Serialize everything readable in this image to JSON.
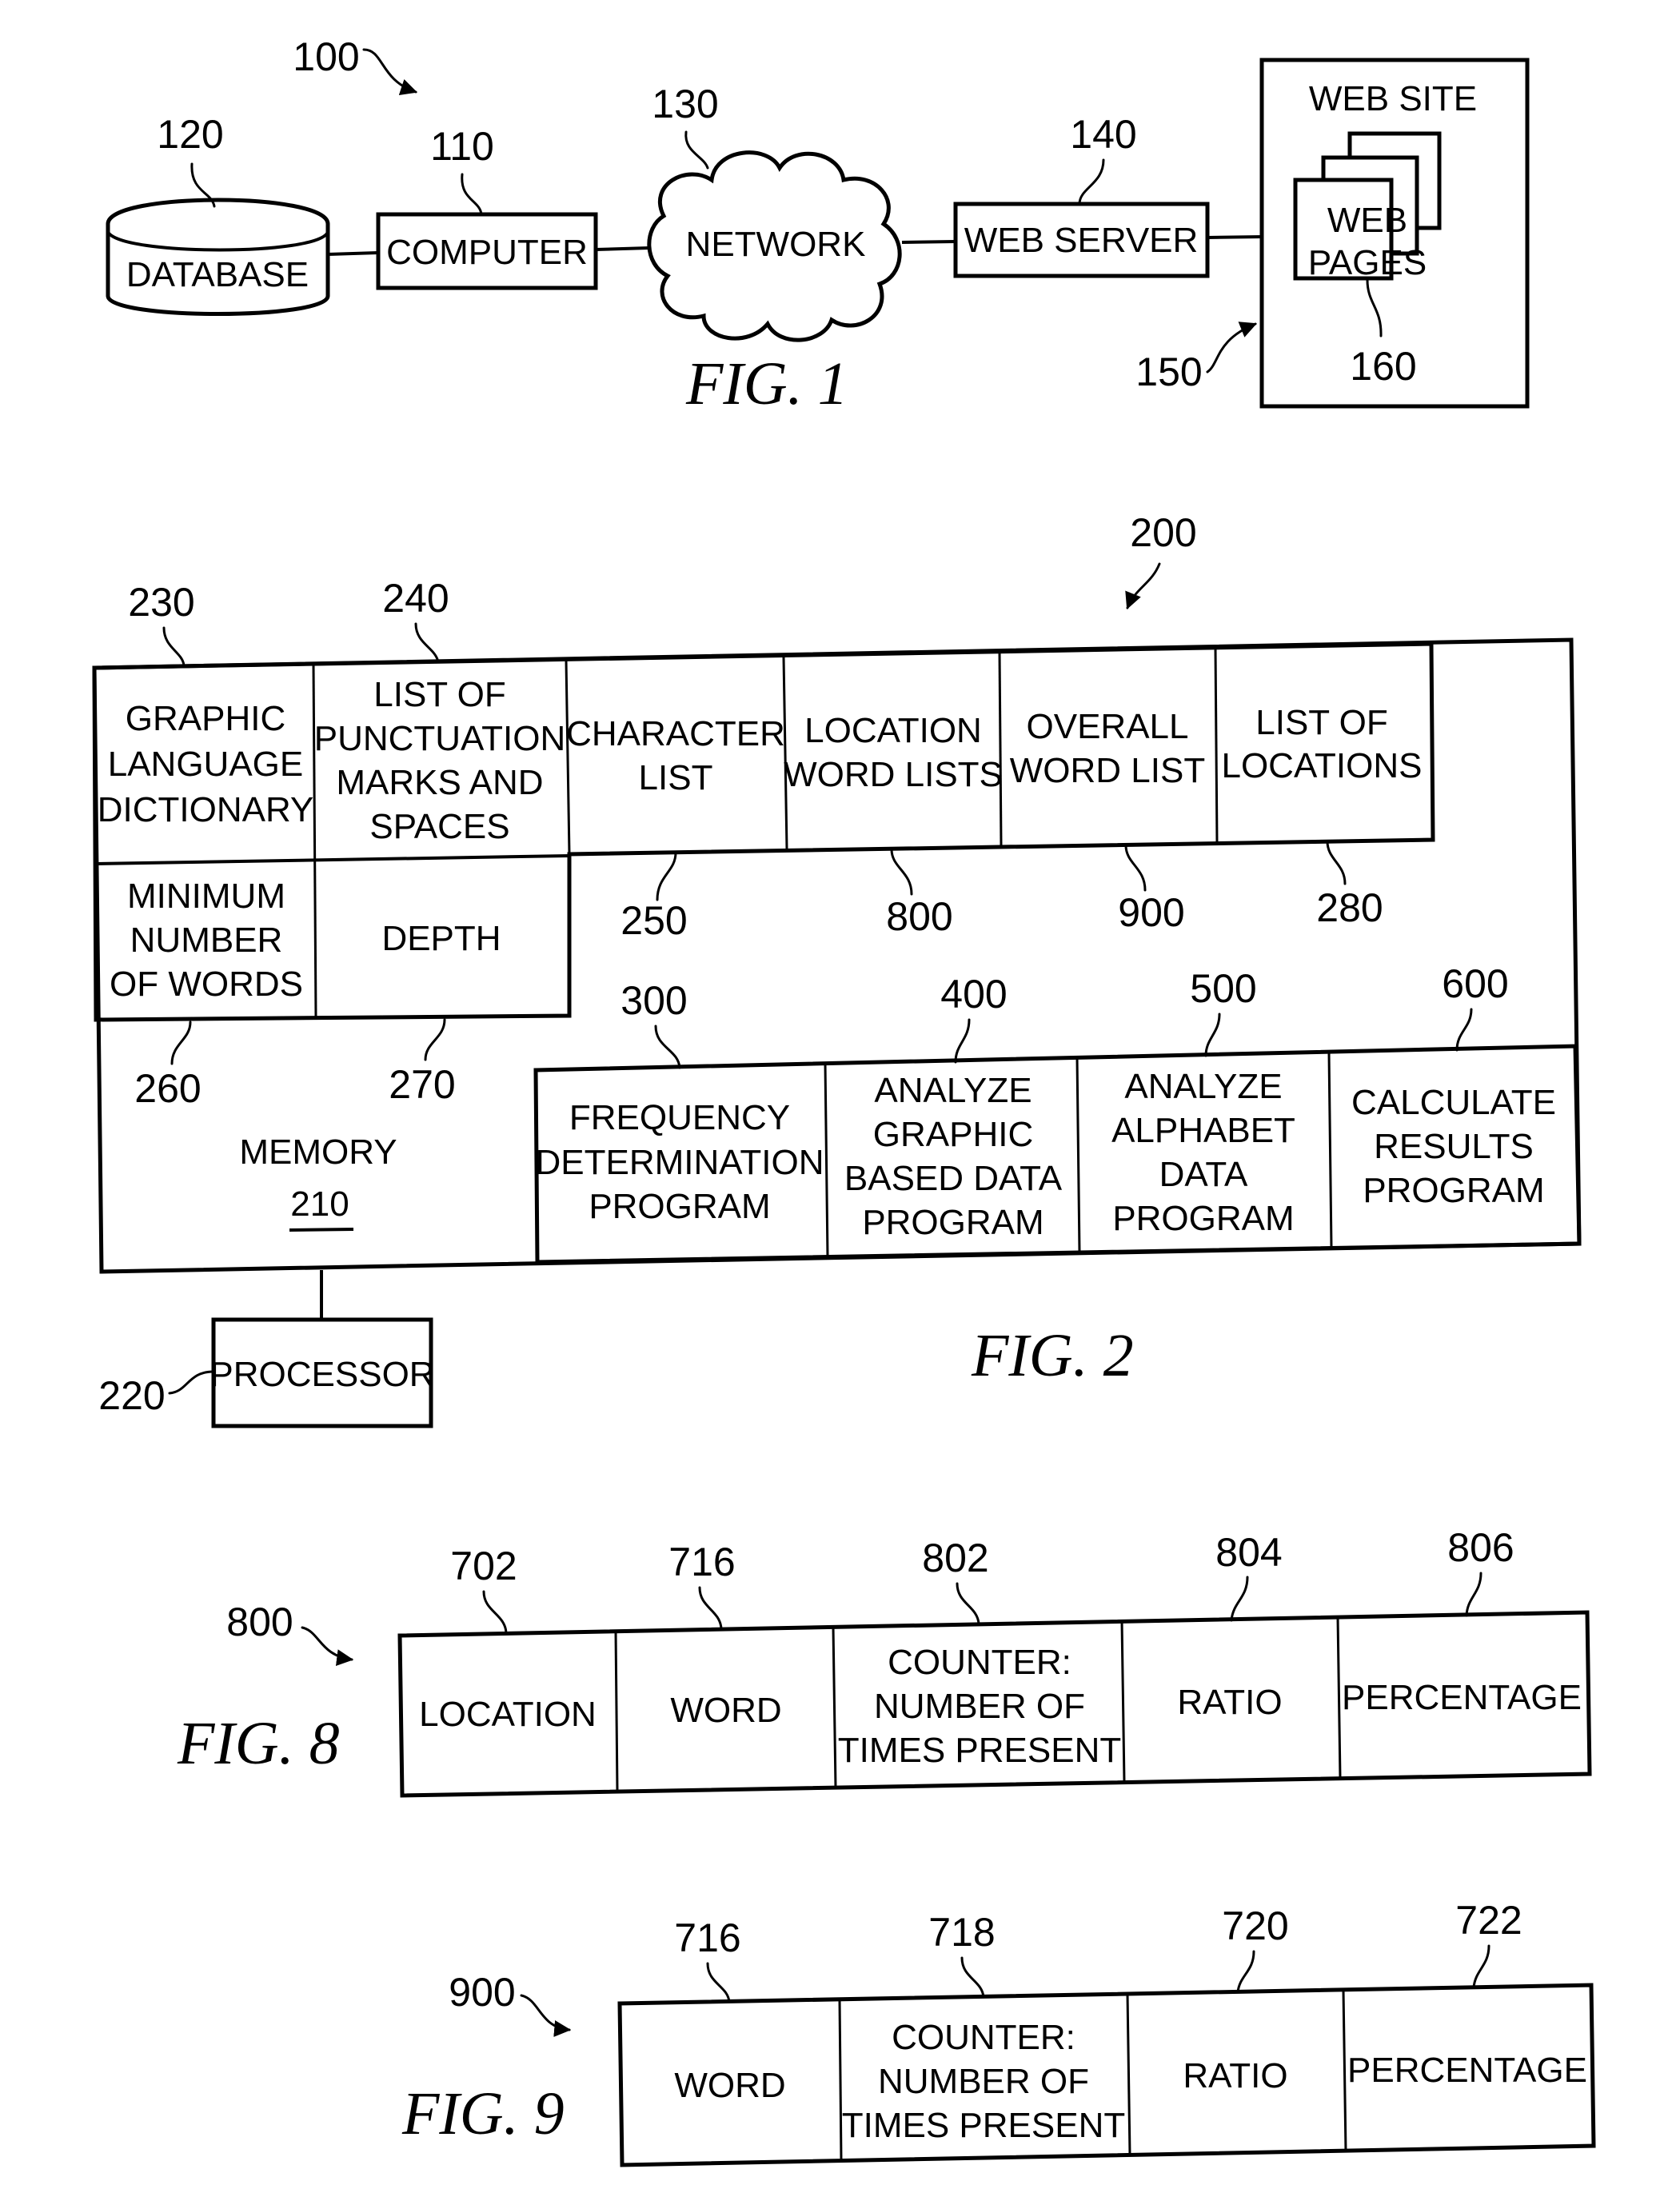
{
  "fig1": {
    "caption": "FIG. 1",
    "system_ref": "100",
    "database": {
      "label": "DATABASE",
      "ref": "120"
    },
    "computer": {
      "label": "COMPUTER",
      "ref": "110"
    },
    "network": {
      "label": "NETWORK",
      "ref": "130"
    },
    "web_server": {
      "label": "WEB SERVER",
      "ref": "140"
    },
    "web_site": {
      "label": "WEB SITE",
      "ref": "150"
    },
    "web_pages": {
      "label_lines": [
        "WEB",
        "PAGES"
      ],
      "ref": "160"
    }
  },
  "fig2": {
    "caption": "FIG. 2",
    "system_ref": "200",
    "memory": {
      "label": "MEMORY",
      "ref": "210"
    },
    "processor": {
      "label": "PROCESSOR",
      "ref": "220"
    },
    "top_cells": [
      {
        "lines": [
          "GRAPHIC",
          "LANGUAGE",
          "DICTIONARY"
        ],
        "ref": "230"
      },
      {
        "lines": [
          "LIST OF",
          "PUNCTUATION",
          "MARKS AND",
          "SPACES"
        ],
        "ref": "240"
      },
      {
        "lines": [
          "CHARACTER",
          "LIST"
        ],
        "ref": "250"
      },
      {
        "lines": [
          "LOCATION",
          "WORD LISTS"
        ],
        "ref": "800"
      },
      {
        "lines": [
          "OVERALL",
          "WORD LIST"
        ],
        "ref": "900"
      },
      {
        "lines": [
          "LIST OF",
          "LOCATIONS"
        ],
        "ref": "280"
      }
    ],
    "second_row_cells": [
      {
        "lines": [
          "MINIMUM",
          "NUMBER",
          "OF WORDS"
        ],
        "ref": "260"
      },
      {
        "lines": [
          "DEPTH"
        ],
        "ref": "270"
      }
    ],
    "program_cells": [
      {
        "lines": [
          "FREQUENCY",
          "DETERMINATION",
          "PROGRAM"
        ],
        "ref": "300"
      },
      {
        "lines": [
          "ANALYZE",
          "GRAPHIC",
          "BASED DATA",
          "PROGRAM"
        ],
        "ref": "400"
      },
      {
        "lines": [
          "ANALYZE",
          "ALPHABET",
          "DATA",
          "PROGRAM"
        ],
        "ref": "500"
      },
      {
        "lines": [
          "CALCULATE",
          "RESULTS",
          "PROGRAM"
        ],
        "ref": "600"
      }
    ]
  },
  "fig8": {
    "caption": "FIG. 8",
    "system_ref": "800",
    "cells": [
      {
        "lines": [
          "LOCATION"
        ],
        "ref": "702"
      },
      {
        "lines": [
          "WORD"
        ],
        "ref": "716"
      },
      {
        "lines": [
          "COUNTER:",
          "NUMBER OF",
          "TIMES PRESENT"
        ],
        "ref": "802"
      },
      {
        "lines": [
          "RATIO"
        ],
        "ref": "804"
      },
      {
        "lines": [
          "PERCENTAGE"
        ],
        "ref": "806"
      }
    ]
  },
  "fig9": {
    "caption": "FIG. 9",
    "system_ref": "900",
    "cells": [
      {
        "lines": [
          "WORD"
        ],
        "ref": "716"
      },
      {
        "lines": [
          "COUNTER:",
          "NUMBER OF",
          "TIMES PRESENT"
        ],
        "ref": "718"
      },
      {
        "lines": [
          "RATIO"
        ],
        "ref": "720"
      },
      {
        "lines": [
          "PERCENTAGE"
        ],
        "ref": "722"
      }
    ]
  }
}
